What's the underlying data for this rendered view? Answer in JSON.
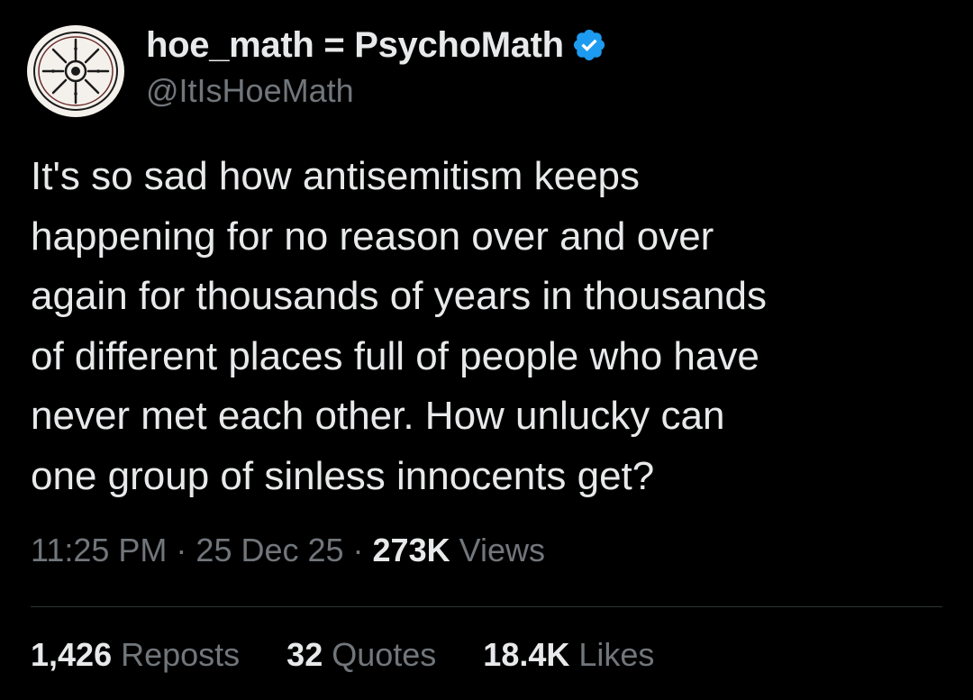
{
  "author": {
    "display_name": "hoe_math = PsychoMath",
    "handle": "@ItIsHoeMath",
    "verified": true,
    "verified_color": "#1d9bf0",
    "avatar_icon": "sun-symbol-avatar"
  },
  "tweet": {
    "text": "It's so sad how antisemitism keeps\nhappening for no reason over and over\nagain for thousands of years in thousands\nof different places full of people who have\nnever met each other. How unlucky can\none group of sinless innocents get?"
  },
  "meta": {
    "time": "11:25 PM",
    "separator": "·",
    "date": "25 Dec 25",
    "views_count": "273K",
    "views_label": "Views"
  },
  "stats": [
    {
      "count": "1,426",
      "label": "Reposts"
    },
    {
      "count": "32",
      "label": "Quotes"
    },
    {
      "count": "18.4K",
      "label": "Likes"
    }
  ],
  "colors": {
    "background": "#000000",
    "primary_text": "#e7e9ea",
    "secondary_text": "#71767b",
    "divider": "#2f3336"
  }
}
